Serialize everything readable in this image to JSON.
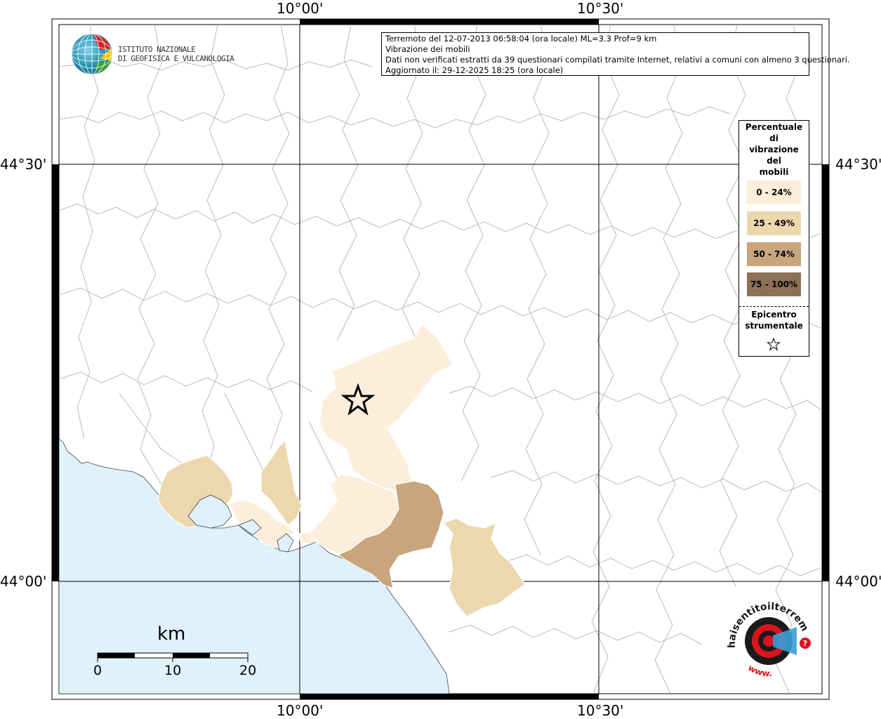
{
  "info": {
    "line1": "Terremoto del 12-07-2013 06:58:04 (ora locale) ML=3.3 Prof=9 km",
    "line2": "Vibrazione dei mobili",
    "line3": "Dati non verificati estratti da 39 questionari compilati tramite Internet, relativi a comuni con almeno 3 questionari.",
    "line4": "Aggiornato il: 29-12-2025 18:25 (ora locale)"
  },
  "logo": {
    "line1": "ISTITUTO NAZIONALE",
    "line2": "DI GEOFISICA E VULCANOLOGIA"
  },
  "coords": {
    "top_left_lon": "10°00'",
    "top_right_lon": "10°30'",
    "bottom_left_lon": "10°00'",
    "bottom_right_lon": "10°30'",
    "left_upper_lat": "44°30'",
    "left_lower_lat": "44°00'",
    "right_upper_lat": "44°30'",
    "right_lower_lat": "44°00'"
  },
  "legend": {
    "title": [
      "Percentuale",
      "di",
      "vibrazione",
      "del",
      "mobili"
    ],
    "classes": [
      {
        "label": "0 - 24%",
        "color": "#fdeedb"
      },
      {
        "label": "25 - 49%",
        "color": "#edd7ae"
      },
      {
        "label": "50 - 74%",
        "color": "#c8a57c"
      },
      {
        "label": "75 - 100%",
        "color": "#8b7155"
      }
    ],
    "epicenter_label": [
      "Epicentro",
      "strumentale"
    ]
  },
  "scale": {
    "unit": "km",
    "labels": [
      "0",
      "10",
      "20"
    ]
  },
  "badge": {
    "text": "haisentitoilterremoto.it",
    "prefix": "www."
  },
  "colors": {
    "sea": "#dff1fc",
    "border": "#b9b9b9",
    "class1": "#fdeedb",
    "class2": "#edd7ae",
    "class3": "#c8a57c",
    "accent_red": "#d9141f"
  },
  "icons": {
    "epicenter": "star-icon",
    "logo": "ingv-globe-icon",
    "badge": "haisentito-logo-icon"
  }
}
